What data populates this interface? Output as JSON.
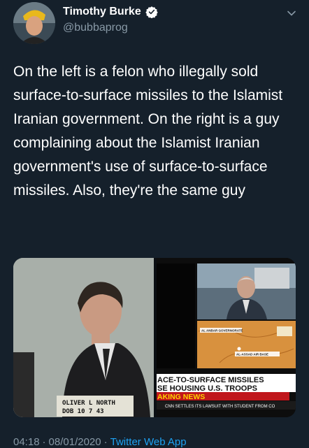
{
  "author": {
    "display_name": "Timothy Burke",
    "handle": "@bubbaprog",
    "verified": true
  },
  "tweet": {
    "text": "On the left is a felon who illegally sold surface-to-surface missiles to the Islamist Iranian government. On the right is a guy complaining about the Islamist Iranian government's use of surface-to-surface missiles. Also, they're the same guy"
  },
  "media": {
    "mugshot_placard_line1": "OLIVER L NORTH",
    "mugshot_placard_line2": "DOB 10 7 43",
    "map_label_1": "AL ANBAR GOVERNORATE",
    "map_label_2": "AL-ASSAD AIR BASE",
    "chyron_line1": "ACE-TO-SURFACE MISSILES",
    "chyron_line2": "SE HOUSING U.S. TROOPS",
    "chyron_breaking": "AKING NEWS",
    "ticker_text": "CNN SETTLES ITS LAWSUIT WITH STUDENT FROM CO"
  },
  "meta": {
    "time": "04:18",
    "separator": "·",
    "date": "08/01/2020",
    "app": "Twitter Web App"
  },
  "colors": {
    "background": "#15202b",
    "secondary_text": "#8899a6",
    "accent": "#1da1f2"
  }
}
